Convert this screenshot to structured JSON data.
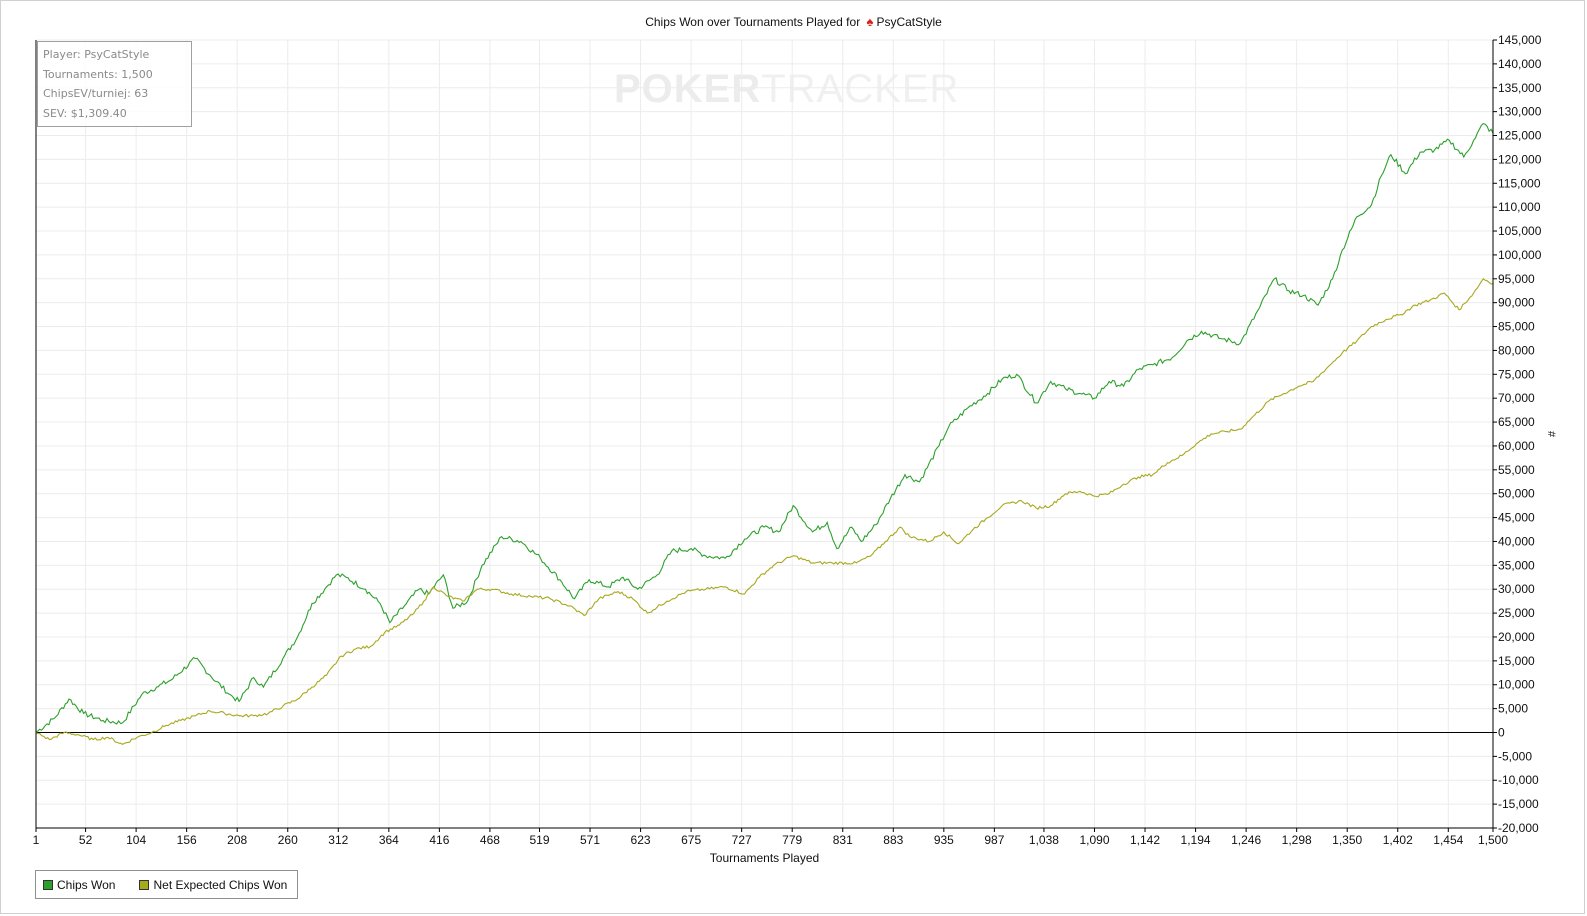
{
  "title": {
    "prefix": "Chips Won over Tournaments Played for",
    "player": "PsyCatStyle"
  },
  "watermark": {
    "part1": "POKER",
    "part2": "TRACKER"
  },
  "info_box": {
    "player": "Player: PsyCatStyle",
    "tournaments": "Tournaments: 1,500",
    "chips_ev": "ChipsEV/turniej: 63",
    "sev": "SEV: $1,309.40"
  },
  "legend": {
    "items": [
      {
        "label": "Chips Won",
        "color": "#2ca02c"
      },
      {
        "label": "Net Expected Chips Won",
        "color": "#a8a81e"
      }
    ]
  },
  "chart_data": {
    "type": "line",
    "xlabel": "Tournaments Played",
    "ylabel": "#",
    "xlim": [
      1,
      1500
    ],
    "ylim": [
      -20000,
      145000
    ],
    "x_ticks": [
      "1",
      "52",
      "104",
      "156",
      "208",
      "260",
      "312",
      "364",
      "416",
      "468",
      "519",
      "571",
      "623",
      "675",
      "727",
      "779",
      "831",
      "883",
      "935",
      "987",
      "1,038",
      "1,090",
      "1,142",
      "1,194",
      "1,246",
      "1,298",
      "1,350",
      "1,402",
      "1,454",
      "1,500"
    ],
    "y_ticks": [
      "-20,000",
      "-15,000",
      "-10,000",
      "-5,000",
      "0",
      "5,000",
      "10,000",
      "15,000",
      "20,000",
      "25,000",
      "30,000",
      "35,000",
      "40,000",
      "45,000",
      "50,000",
      "55,000",
      "60,000",
      "65,000",
      "70,000",
      "75,000",
      "80,000",
      "85,000",
      "90,000",
      "95,000",
      "100,000",
      "105,000",
      "110,000",
      "115,000",
      "120,000",
      "125,000",
      "130,000",
      "135,000",
      "140,000",
      "145,000"
    ],
    "grid": true,
    "legend_position": "bottom-left",
    "series": [
      {
        "name": "Chips Won",
        "color": "#2ca02c",
        "points": [
          [
            1,
            0
          ],
          [
            20,
            3000
          ],
          [
            35,
            7000
          ],
          [
            50,
            4000
          ],
          [
            70,
            2500
          ],
          [
            90,
            2000
          ],
          [
            110,
            8000
          ],
          [
            125,
            9500
          ],
          [
            140,
            11000
          ],
          [
            165,
            15500
          ],
          [
            180,
            12000
          ],
          [
            200,
            8000
          ],
          [
            210,
            6500
          ],
          [
            225,
            11500
          ],
          [
            235,
            9500
          ],
          [
            255,
            15500
          ],
          [
            270,
            20000
          ],
          [
            285,
            27000
          ],
          [
            300,
            30500
          ],
          [
            310,
            33000
          ],
          [
            320,
            32500
          ],
          [
            340,
            30000
          ],
          [
            355,
            27000
          ],
          [
            365,
            23000
          ],
          [
            380,
            26500
          ],
          [
            395,
            30000
          ],
          [
            405,
            29000
          ],
          [
            420,
            33000
          ],
          [
            430,
            26000
          ],
          [
            445,
            27500
          ],
          [
            460,
            35000
          ],
          [
            480,
            41000
          ],
          [
            500,
            40000
          ],
          [
            520,
            36500
          ],
          [
            540,
            32000
          ],
          [
            555,
            28000
          ],
          [
            570,
            32000
          ],
          [
            590,
            30500
          ],
          [
            605,
            32500
          ],
          [
            620,
            30000
          ],
          [
            640,
            33000
          ],
          [
            655,
            38000
          ],
          [
            675,
            38500
          ],
          [
            690,
            37000
          ],
          [
            710,
            36500
          ],
          [
            730,
            40500
          ],
          [
            750,
            43000
          ],
          [
            765,
            42000
          ],
          [
            780,
            47500
          ],
          [
            800,
            42000
          ],
          [
            815,
            44000
          ],
          [
            825,
            38500
          ],
          [
            840,
            43000
          ],
          [
            850,
            40000
          ],
          [
            865,
            43500
          ],
          [
            880,
            49000
          ],
          [
            895,
            54000
          ],
          [
            910,
            52500
          ],
          [
            930,
            60000
          ],
          [
            940,
            64000
          ],
          [
            960,
            68000
          ],
          [
            980,
            71000
          ],
          [
            995,
            74000
          ],
          [
            1010,
            75000
          ],
          [
            1030,
            69000
          ],
          [
            1045,
            73500
          ],
          [
            1060,
            72000
          ],
          [
            1075,
            71000
          ],
          [
            1090,
            70000
          ],
          [
            1105,
            73500
          ],
          [
            1120,
            72500
          ],
          [
            1135,
            76000
          ],
          [
            1150,
            77000
          ],
          [
            1170,
            78500
          ],
          [
            1185,
            82000
          ],
          [
            1200,
            84000
          ],
          [
            1220,
            82500
          ],
          [
            1240,
            81500
          ],
          [
            1260,
            89000
          ],
          [
            1275,
            95000
          ],
          [
            1290,
            92500
          ],
          [
            1305,
            91500
          ],
          [
            1320,
            89500
          ],
          [
            1335,
            95000
          ],
          [
            1345,
            101000
          ],
          [
            1360,
            108000
          ],
          [
            1375,
            110500
          ],
          [
            1385,
            116500
          ],
          [
            1395,
            121000
          ],
          [
            1410,
            117000
          ],
          [
            1425,
            121500
          ],
          [
            1440,
            122000
          ],
          [
            1455,
            124000
          ],
          [
            1470,
            120500
          ],
          [
            1480,
            124000
          ],
          [
            1490,
            127500
          ],
          [
            1500,
            125500
          ]
        ]
      },
      {
        "name": "Net Expected Chips Won",
        "color": "#a8a81e",
        "points": [
          [
            1,
            0
          ],
          [
            15,
            -1500
          ],
          [
            30,
            0
          ],
          [
            45,
            -500
          ],
          [
            60,
            -1500
          ],
          [
            75,
            -1000
          ],
          [
            90,
            -2500
          ],
          [
            105,
            -1000
          ],
          [
            120,
            0
          ],
          [
            135,
            1500
          ],
          [
            150,
            2500
          ],
          [
            165,
            3500
          ],
          [
            180,
            4500
          ],
          [
            195,
            4000
          ],
          [
            210,
            3500
          ],
          [
            225,
            3500
          ],
          [
            240,
            4000
          ],
          [
            255,
            5500
          ],
          [
            270,
            7000
          ],
          [
            285,
            9500
          ],
          [
            300,
            12000
          ],
          [
            315,
            16000
          ],
          [
            330,
            17500
          ],
          [
            345,
            18000
          ],
          [
            360,
            21000
          ],
          [
            375,
            22500
          ],
          [
            390,
            25000
          ],
          [
            400,
            27500
          ],
          [
            410,
            30500
          ],
          [
            425,
            28500
          ],
          [
            440,
            27500
          ],
          [
            455,
            30000
          ],
          [
            470,
            30000
          ],
          [
            490,
            29000
          ],
          [
            510,
            28500
          ],
          [
            530,
            28000
          ],
          [
            550,
            26500
          ],
          [
            565,
            24500
          ],
          [
            580,
            28000
          ],
          [
            600,
            29500
          ],
          [
            615,
            28000
          ],
          [
            630,
            25000
          ],
          [
            650,
            27500
          ],
          [
            670,
            29500
          ],
          [
            690,
            30000
          ],
          [
            710,
            30500
          ],
          [
            730,
            29000
          ],
          [
            745,
            32500
          ],
          [
            760,
            35000
          ],
          [
            780,
            37000
          ],
          [
            800,
            35500
          ],
          [
            820,
            35500
          ],
          [
            845,
            35500
          ],
          [
            860,
            37000
          ],
          [
            875,
            40000
          ],
          [
            890,
            43000
          ],
          [
            900,
            41000
          ],
          [
            920,
            40000
          ],
          [
            935,
            42000
          ],
          [
            950,
            39500
          ],
          [
            965,
            42500
          ],
          [
            980,
            45000
          ],
          [
            995,
            47500
          ],
          [
            1015,
            48500
          ],
          [
            1030,
            47000
          ],
          [
            1045,
            47500
          ],
          [
            1060,
            50000
          ],
          [
            1075,
            50500
          ],
          [
            1090,
            49500
          ],
          [
            1105,
            50000
          ],
          [
            1120,
            52000
          ],
          [
            1135,
            53500
          ],
          [
            1150,
            54000
          ],
          [
            1165,
            56500
          ],
          [
            1180,
            58000
          ],
          [
            1195,
            60500
          ],
          [
            1210,
            62500
          ],
          [
            1225,
            63000
          ],
          [
            1240,
            63500
          ],
          [
            1255,
            66500
          ],
          [
            1270,
            69500
          ],
          [
            1285,
            71000
          ],
          [
            1300,
            72500
          ],
          [
            1315,
            73500
          ],
          [
            1330,
            76500
          ],
          [
            1345,
            79500
          ],
          [
            1360,
            82000
          ],
          [
            1375,
            85000
          ],
          [
            1390,
            86500
          ],
          [
            1405,
            87500
          ],
          [
            1420,
            89500
          ],
          [
            1435,
            90500
          ],
          [
            1450,
            92000
          ],
          [
            1465,
            88500
          ],
          [
            1480,
            92000
          ],
          [
            1490,
            95000
          ],
          [
            1500,
            94000
          ]
        ]
      }
    ]
  }
}
